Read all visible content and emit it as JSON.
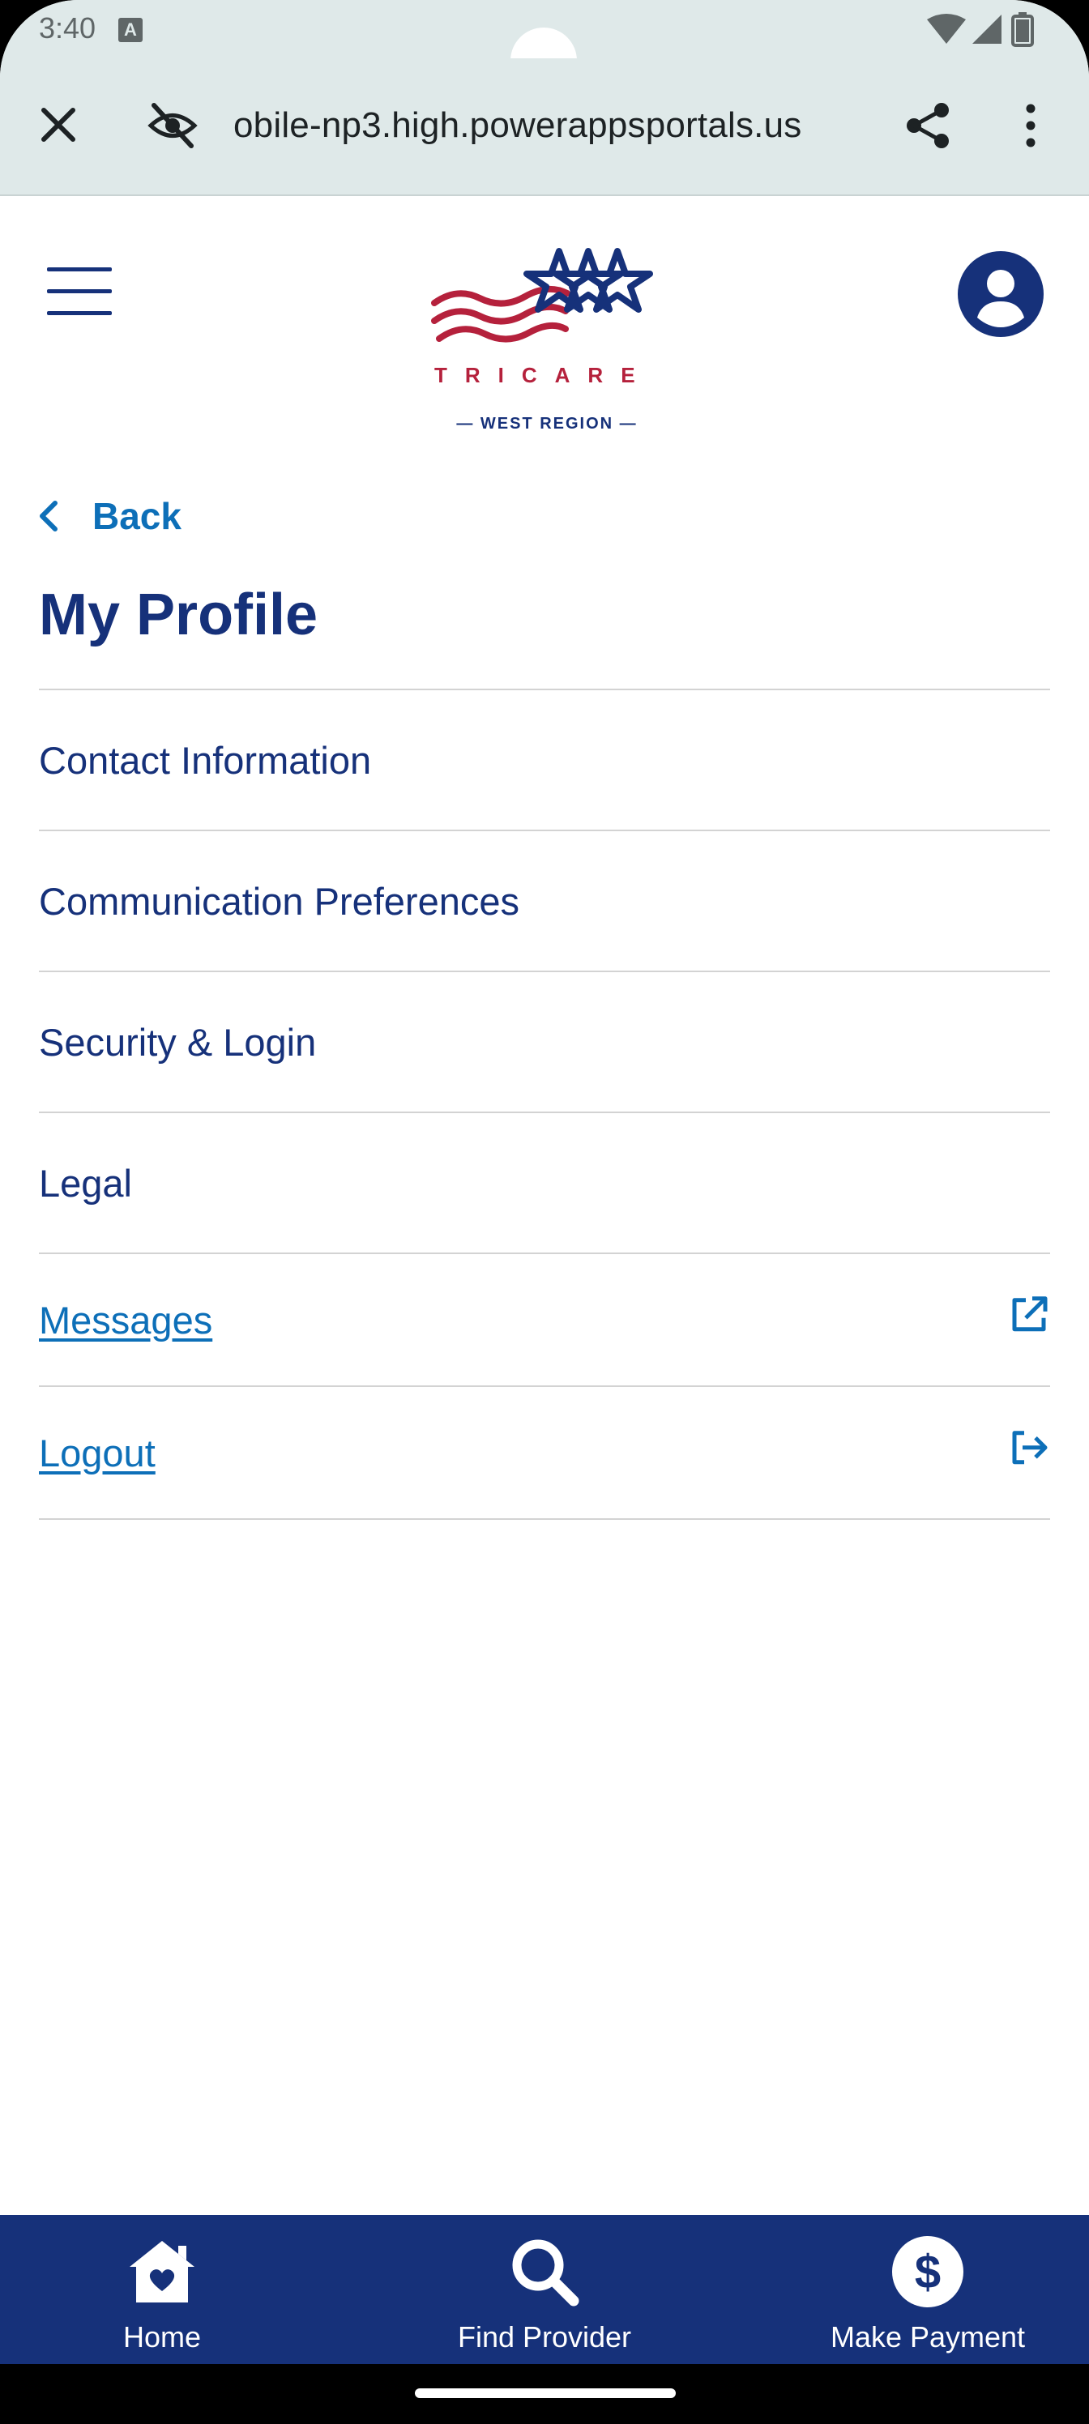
{
  "status_bar": {
    "time": "3:40",
    "notification_letter": "A",
    "icons": [
      "wifi-icon",
      "signal-icon",
      "battery-icon"
    ]
  },
  "browser": {
    "url": "obile-np3.high.powerappsportals.us",
    "icons": [
      "close-icon",
      "eye-off-icon",
      "share-icon",
      "more-vert-icon"
    ]
  },
  "header": {
    "logo_word": "TRICARE",
    "logo_region": "— WEST REGION —",
    "icons": [
      "hamburger-menu-icon",
      "account-circle-icon"
    ]
  },
  "main": {
    "back_label": "Back",
    "title": "My Profile",
    "items": [
      {
        "label": "Contact Information"
      },
      {
        "label": "Communication Preferences"
      },
      {
        "label": "Security & Login"
      },
      {
        "label": "Legal"
      },
      {
        "label": "Messages",
        "icon": "external-link-icon"
      },
      {
        "label": "Logout",
        "icon": "logout-icon"
      }
    ]
  },
  "bottom_nav": {
    "items": [
      {
        "label": "Home",
        "icon": "home-icon"
      },
      {
        "label": "Find Provider",
        "icon": "search-icon"
      },
      {
        "label": "Make Payment",
        "icon": "dollar-circle-icon"
      }
    ]
  },
  "colors": {
    "brand_navy": "#16317a",
    "link_blue": "#0d6fb8",
    "brand_red": "#b5213c",
    "chrome_bg": "#dfe9e9"
  }
}
